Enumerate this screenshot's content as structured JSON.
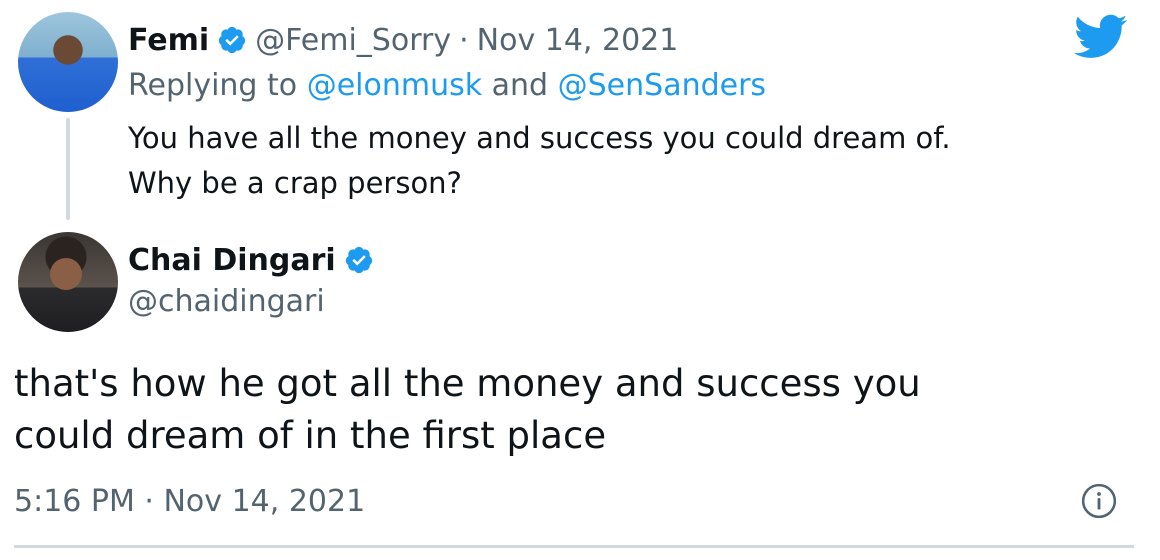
{
  "reply_tweet": {
    "display_name": "Femi",
    "handle": "@Femi_Sorry",
    "separator": "·",
    "date": "Nov 14, 2021",
    "replying_prefix": "Replying to",
    "replying_user1": "@elonmusk",
    "replying_and": "and",
    "replying_user2": "@SenSanders",
    "text_line1": "You have all the money and success you could dream of.",
    "text_line2": "Why be a crap person?"
  },
  "main_tweet": {
    "display_name": "Chai Dingari",
    "handle": "@chaidingari",
    "text_line1": "that's how he got all the money and success you",
    "text_line2": "could dream of in the first place",
    "timestamp": "5:16 PM · Nov 14, 2021"
  },
  "icons": {
    "verified": "verified-badge-icon",
    "bird": "twitter-bird-icon",
    "info": "info-icon"
  },
  "colors": {
    "accent": "#1d9bf0",
    "text": "#0f1419",
    "muted": "#536471",
    "divider": "#cfd9de"
  }
}
